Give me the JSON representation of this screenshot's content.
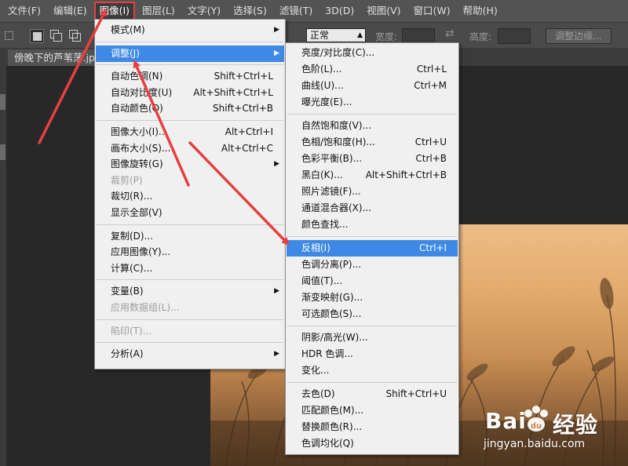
{
  "menubar": {
    "items": [
      "文件(F)",
      "编辑(E)",
      "图像(I)",
      "图层(L)",
      "文字(Y)",
      "选择(S)",
      "滤镜(T)",
      "3D(D)",
      "视图(V)",
      "窗口(W)",
      "帮助(H)"
    ],
    "active_index": 2
  },
  "options_bar": {
    "style_value": "正常",
    "width_label": "宽度:",
    "height_label": "高度:",
    "refine_button": "调整边缘..."
  },
  "document": {
    "tab_title": "傍晚下的芦苇荡.jpg"
  },
  "image_menu": {
    "items": [
      {
        "label": "模式(M)",
        "shortcut": "",
        "submenu": true,
        "disabled": false
      },
      {
        "sep": true
      },
      {
        "label": "调整(J)",
        "shortcut": "",
        "submenu": true,
        "disabled": false,
        "highlight": true
      },
      {
        "sep": true
      },
      {
        "label": "自动色调(N)",
        "shortcut": "Shift+Ctrl+L"
      },
      {
        "label": "自动对比度(U)",
        "shortcut": "Alt+Shift+Ctrl+L"
      },
      {
        "label": "自动颜色(O)",
        "shortcut": "Shift+Ctrl+B"
      },
      {
        "sep": true
      },
      {
        "label": "图像大小(I)...",
        "shortcut": "Alt+Ctrl+I"
      },
      {
        "label": "画布大小(S)...",
        "shortcut": "Alt+Ctrl+C"
      },
      {
        "label": "图像旋转(G)",
        "shortcut": "",
        "submenu": true
      },
      {
        "label": "裁剪(P)",
        "shortcut": "",
        "disabled": true
      },
      {
        "label": "裁切(R)...",
        "shortcut": ""
      },
      {
        "label": "显示全部(V)",
        "shortcut": ""
      },
      {
        "sep": true
      },
      {
        "label": "复制(D)...",
        "shortcut": ""
      },
      {
        "label": "应用图像(Y)...",
        "shortcut": ""
      },
      {
        "label": "计算(C)...",
        "shortcut": ""
      },
      {
        "sep": true
      },
      {
        "label": "变量(B)",
        "shortcut": "",
        "submenu": true
      },
      {
        "label": "应用数据组(L)...",
        "shortcut": "",
        "disabled": true
      },
      {
        "sep": true
      },
      {
        "label": "陷印(T)...",
        "shortcut": "",
        "disabled": true
      },
      {
        "sep": true
      },
      {
        "label": "分析(A)",
        "shortcut": "",
        "submenu": true
      }
    ]
  },
  "adjust_menu": {
    "items": [
      {
        "label": "亮度/对比度(C)...",
        "shortcut": ""
      },
      {
        "label": "色阶(L)...",
        "shortcut": "Ctrl+L"
      },
      {
        "label": "曲线(U)...",
        "shortcut": "Ctrl+M"
      },
      {
        "label": "曝光度(E)...",
        "shortcut": ""
      },
      {
        "sep": true
      },
      {
        "label": "自然饱和度(V)...",
        "shortcut": ""
      },
      {
        "label": "色相/饱和度(H)...",
        "shortcut": "Ctrl+U"
      },
      {
        "label": "色彩平衡(B)...",
        "shortcut": "Ctrl+B"
      },
      {
        "label": "黑白(K)...",
        "shortcut": "Alt+Shift+Ctrl+B"
      },
      {
        "label": "照片滤镜(F)...",
        "shortcut": ""
      },
      {
        "label": "通道混合器(X)...",
        "shortcut": ""
      },
      {
        "label": "颜色查找...",
        "shortcut": ""
      },
      {
        "sep": true
      },
      {
        "label": "反相(I)",
        "shortcut": "Ctrl+I",
        "highlight": true
      },
      {
        "label": "色调分离(P)...",
        "shortcut": ""
      },
      {
        "label": "阈值(T)...",
        "shortcut": ""
      },
      {
        "label": "渐变映射(G)...",
        "shortcut": ""
      },
      {
        "label": "可选颜色(S)...",
        "shortcut": ""
      },
      {
        "sep": true
      },
      {
        "label": "阴影/高光(W)...",
        "shortcut": ""
      },
      {
        "label": "HDR 色调...",
        "shortcut": ""
      },
      {
        "label": "变化...",
        "shortcut": ""
      },
      {
        "sep": true
      },
      {
        "label": "去色(D)",
        "shortcut": "Shift+Ctrl+U"
      },
      {
        "label": "匹配颜色(M)...",
        "shortcut": ""
      },
      {
        "label": "替换颜色(R)...",
        "shortcut": ""
      },
      {
        "label": "色调均化(Q)",
        "shortcut": ""
      }
    ]
  },
  "watermark": {
    "brand": "Bai",
    "brand_suffix": "经验",
    "url": "jingyan.baidu.com"
  },
  "icons": {
    "submenu_arrow": "chevron-right-icon",
    "paw": "baidu-paw-icon",
    "swap": "swap-arrows-icon"
  },
  "colors": {
    "highlight": "#3e89e6",
    "annotation_arrow": "#e64040",
    "menubar": "#535353"
  }
}
